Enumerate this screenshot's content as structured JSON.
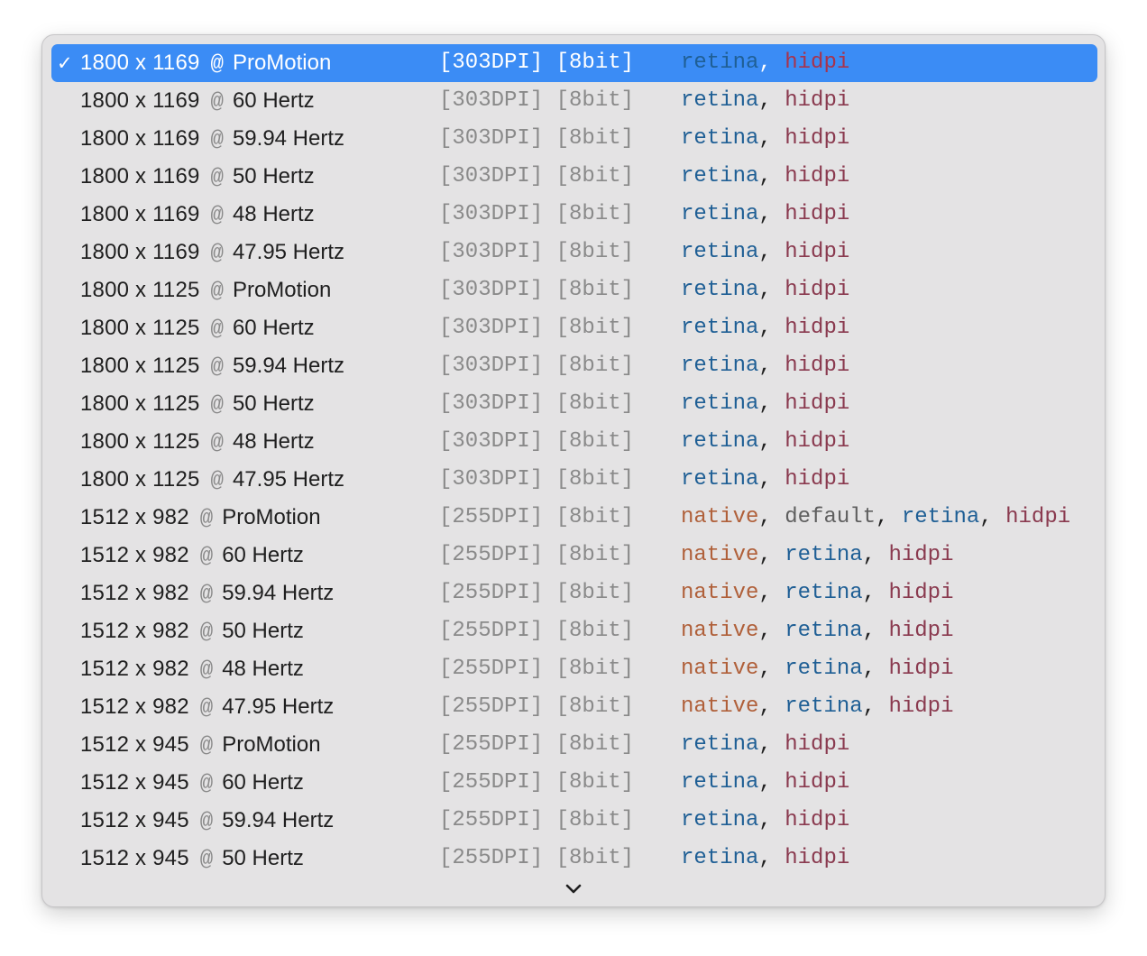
{
  "menu": {
    "items": [
      {
        "check": "✓",
        "res": "1800 x 1169",
        "sep": "@",
        "rate": "ProMotion",
        "dpi": "[303DPI]",
        "bits": "[8bit]",
        "tags": [
          "retina",
          "hidpi"
        ]
      },
      {
        "check": "",
        "res": "1800 x 1169",
        "sep": "@",
        "rate": "60 Hertz",
        "dpi": "[303DPI]",
        "bits": "[8bit]",
        "tags": [
          "retina",
          "hidpi"
        ]
      },
      {
        "check": "",
        "res": "1800 x 1169",
        "sep": "@",
        "rate": "59.94 Hertz",
        "dpi": "[303DPI]",
        "bits": "[8bit]",
        "tags": [
          "retina",
          "hidpi"
        ]
      },
      {
        "check": "",
        "res": "1800 x 1169",
        "sep": "@",
        "rate": "50 Hertz",
        "dpi": "[303DPI]",
        "bits": "[8bit]",
        "tags": [
          "retina",
          "hidpi"
        ]
      },
      {
        "check": "",
        "res": "1800 x 1169",
        "sep": "@",
        "rate": "48 Hertz",
        "dpi": "[303DPI]",
        "bits": "[8bit]",
        "tags": [
          "retina",
          "hidpi"
        ]
      },
      {
        "check": "",
        "res": "1800 x 1169",
        "sep": "@",
        "rate": "47.95 Hertz",
        "dpi": "[303DPI]",
        "bits": "[8bit]",
        "tags": [
          "retina",
          "hidpi"
        ]
      },
      {
        "check": "",
        "res": "1800 x 1125",
        "sep": "@",
        "rate": "ProMotion",
        "dpi": "[303DPI]",
        "bits": "[8bit]",
        "tags": [
          "retina",
          "hidpi"
        ]
      },
      {
        "check": "",
        "res": "1800 x 1125",
        "sep": "@",
        "rate": "60 Hertz",
        "dpi": "[303DPI]",
        "bits": "[8bit]",
        "tags": [
          "retina",
          "hidpi"
        ]
      },
      {
        "check": "",
        "res": "1800 x 1125",
        "sep": "@",
        "rate": "59.94 Hertz",
        "dpi": "[303DPI]",
        "bits": "[8bit]",
        "tags": [
          "retina",
          "hidpi"
        ]
      },
      {
        "check": "",
        "res": "1800 x 1125",
        "sep": "@",
        "rate": "50 Hertz",
        "dpi": "[303DPI]",
        "bits": "[8bit]",
        "tags": [
          "retina",
          "hidpi"
        ]
      },
      {
        "check": "",
        "res": "1800 x 1125",
        "sep": "@",
        "rate": "48 Hertz",
        "dpi": "[303DPI]",
        "bits": "[8bit]",
        "tags": [
          "retina",
          "hidpi"
        ]
      },
      {
        "check": "",
        "res": "1800 x 1125",
        "sep": "@",
        "rate": "47.95 Hertz",
        "dpi": "[303DPI]",
        "bits": "[8bit]",
        "tags": [
          "retina",
          "hidpi"
        ]
      },
      {
        "check": "",
        "res": "1512 x 982",
        "sep": "@",
        "rate": "ProMotion",
        "dpi": "[255DPI]",
        "bits": "[8bit]",
        "tags": [
          "native",
          "default",
          "retina",
          "hidpi"
        ]
      },
      {
        "check": "",
        "res": "1512 x 982",
        "sep": "@",
        "rate": "60 Hertz",
        "dpi": "[255DPI]",
        "bits": "[8bit]",
        "tags": [
          "native",
          "retina",
          "hidpi"
        ]
      },
      {
        "check": "",
        "res": "1512 x 982",
        "sep": "@",
        "rate": "59.94 Hertz",
        "dpi": "[255DPI]",
        "bits": "[8bit]",
        "tags": [
          "native",
          "retina",
          "hidpi"
        ]
      },
      {
        "check": "",
        "res": "1512 x 982",
        "sep": "@",
        "rate": "50 Hertz",
        "dpi": "[255DPI]",
        "bits": "[8bit]",
        "tags": [
          "native",
          "retina",
          "hidpi"
        ]
      },
      {
        "check": "",
        "res": "1512 x 982",
        "sep": "@",
        "rate": "48 Hertz",
        "dpi": "[255DPI]",
        "bits": "[8bit]",
        "tags": [
          "native",
          "retina",
          "hidpi"
        ]
      },
      {
        "check": "",
        "res": "1512 x 982",
        "sep": "@",
        "rate": "47.95 Hertz",
        "dpi": "[255DPI]",
        "bits": "[8bit]",
        "tags": [
          "native",
          "retina",
          "hidpi"
        ]
      },
      {
        "check": "",
        "res": "1512 x 945",
        "sep": "@",
        "rate": "ProMotion",
        "dpi": "[255DPI]",
        "bits": "[8bit]",
        "tags": [
          "retina",
          "hidpi"
        ]
      },
      {
        "check": "",
        "res": "1512 x 945",
        "sep": "@",
        "rate": "60 Hertz",
        "dpi": "[255DPI]",
        "bits": "[8bit]",
        "tags": [
          "retina",
          "hidpi"
        ]
      },
      {
        "check": "",
        "res": "1512 x 945",
        "sep": "@",
        "rate": "59.94 Hertz",
        "dpi": "[255DPI]",
        "bits": "[8bit]",
        "tags": [
          "retina",
          "hidpi"
        ]
      },
      {
        "check": "",
        "res": "1512 x 945",
        "sep": "@",
        "rate": "50 Hertz",
        "dpi": "[255DPI]",
        "bits": "[8bit]",
        "tags": [
          "retina",
          "hidpi"
        ]
      }
    ],
    "scroll_indicator": "chevron-down-icon"
  },
  "colors": {
    "selection": "#3b8cf5",
    "menu_bg": "#e4e3e4",
    "native": "#b0603a",
    "default": "#5f5f5f",
    "retina": "#1f5f95",
    "hidpi": "#8a3a4f"
  }
}
